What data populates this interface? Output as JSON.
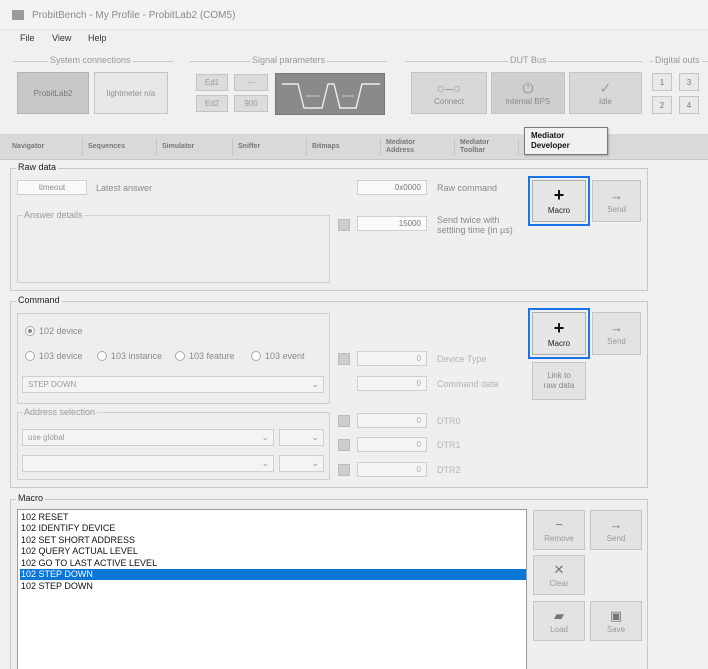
{
  "window": {
    "title": "ProbitBench - My Profile - ProbitLab2 (COM5)"
  },
  "menu": [
    {
      "label": "File"
    },
    {
      "label": "View"
    },
    {
      "label": "Help"
    }
  ],
  "toolbar": {
    "system_connections": {
      "caption": "System connections",
      "primary": "ProbitLab2",
      "secondary": "lightmeter n/a"
    },
    "signal_parameters": {
      "caption": "Signal parameters",
      "buttons": [
        "Ed1",
        "Ed2",
        "---",
        "900"
      ]
    },
    "dut_bus": {
      "caption": "DUT Bus",
      "connect": "Connect",
      "internal_bps": "internal BPS",
      "idle": "Idle"
    },
    "digital_outs": {
      "caption": "Digital outs",
      "buttons": [
        "1",
        "3",
        "2",
        "4"
      ]
    }
  },
  "tabs": [
    {
      "label": "Navigator"
    },
    {
      "label": "Sequences"
    },
    {
      "label": "Simulator"
    },
    {
      "label": "Sniffer"
    },
    {
      "label": "Bitmaps"
    },
    {
      "label": "Mediator Address"
    },
    {
      "label": "Mediator Toolbar"
    }
  ],
  "tooltip": {
    "line1": "Mediator",
    "line2": "Developer"
  },
  "raw_data": {
    "title": "Raw data",
    "timeout_value": "timeout",
    "latest_answer_label": "Latest answer",
    "raw_command_value": "0x0000",
    "raw_command_label": "Raw command",
    "answer_details_title": "Answer details",
    "settling_value": "15000",
    "send_twice_label_1": "Send twice with",
    "send_twice_label_2": "settling time (in µs)",
    "macro_label": "Macro",
    "send_label": "Send"
  },
  "command": {
    "title": "Command",
    "radio_102_device": "102 device",
    "radios": [
      "103 device",
      "103 instance",
      "103 feature",
      "103 event"
    ],
    "command_value": "STEP DOWN",
    "device_type_value": "0",
    "device_type_label": "Device Type",
    "command_data_value": "0",
    "command_data_label": "Command data",
    "address_selection_title": "Address selection",
    "address_value": "use global",
    "dtr_values": [
      "0",
      "0",
      "0"
    ],
    "dtr_labels": [
      "DTR0",
      "DTR1",
      "DTR2"
    ],
    "macro_label": "Macro",
    "send_label": "Send",
    "link_label_1": "Link to",
    "link_label_2": "raw data"
  },
  "macro": {
    "title": "Macro",
    "items": [
      {
        "label": "102 RESET"
      },
      {
        "label": "102 IDENTIFY DEVICE"
      },
      {
        "label": "102 SET SHORT ADDRESS"
      },
      {
        "label": "102 QUERY ACTUAL LEVEL"
      },
      {
        "label": "102 GO TO LAST ACTIVE LEVEL"
      },
      {
        "label": "102 STEP DOWN",
        "selected": true
      },
      {
        "label": "102 STEP DOWN"
      }
    ],
    "remove_label": "Remove",
    "send_label": "Send",
    "clear_label": "Clear",
    "load_label": "Load",
    "save_label": "Save"
  },
  "colors": {
    "selection": "#0a76d6",
    "highlight": "#1a73e8"
  }
}
